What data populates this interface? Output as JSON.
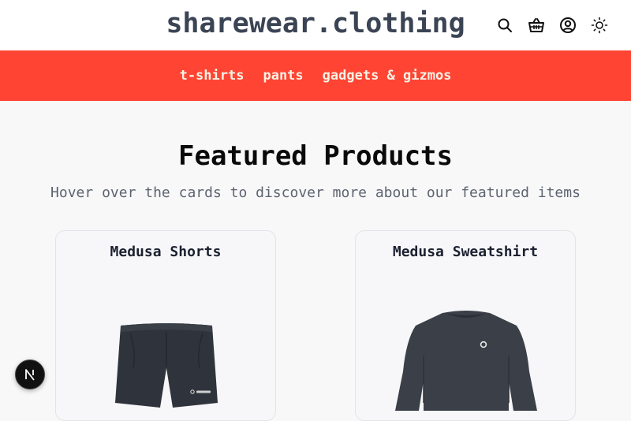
{
  "header": {
    "logo": "sharewear.clothing",
    "icons": [
      "search-icon",
      "basket-icon",
      "account-icon",
      "theme-toggle-icon"
    ]
  },
  "nav": {
    "items": [
      {
        "label": "t-shirts"
      },
      {
        "label": "pants"
      },
      {
        "label": "gadgets & gizmos"
      }
    ]
  },
  "main": {
    "title": "Featured Products",
    "subtitle": "Hover over the cards to discover more about our featured items",
    "products": [
      {
        "name": "Medusa Shorts"
      },
      {
        "name": "Medusa Sweatshirt"
      }
    ]
  },
  "colors": {
    "nav_background": "#ff4433",
    "nav_text": "#f6f3e6",
    "logo": "#3b4454",
    "page_background": "#f8f8f9"
  }
}
